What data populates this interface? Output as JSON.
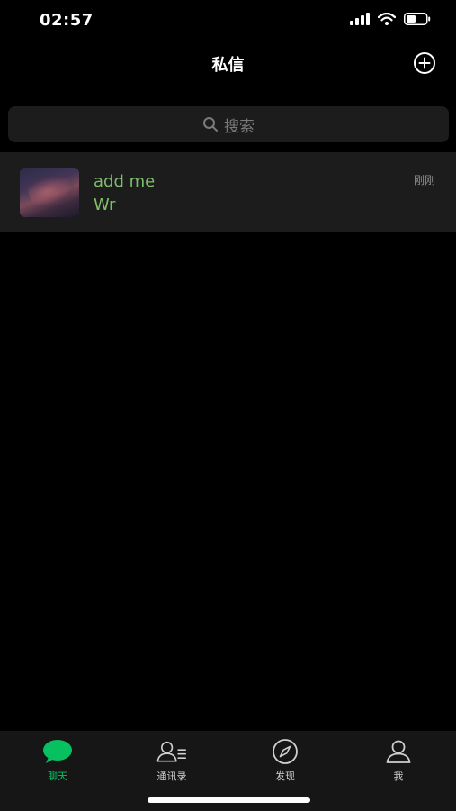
{
  "status_bar": {
    "time": "02:57"
  },
  "nav": {
    "title": "私信",
    "add_icon": "plus-circle-icon"
  },
  "search": {
    "placeholder": "搜索",
    "icon": "search-icon"
  },
  "chats": [
    {
      "name": "add me",
      "preview": "Wr",
      "time": "刚刚",
      "name_color": "#7fbd6a"
    }
  ],
  "tabs": [
    {
      "label": "聊天",
      "icon": "chat-bubble-icon",
      "active": true
    },
    {
      "label": "通讯录",
      "icon": "contacts-icon",
      "active": false
    },
    {
      "label": "发现",
      "icon": "compass-icon",
      "active": false
    },
    {
      "label": "我",
      "icon": "person-icon",
      "active": false
    }
  ],
  "colors": {
    "accent": "#07c160",
    "background": "#000000",
    "row": "#1c1c1c"
  }
}
